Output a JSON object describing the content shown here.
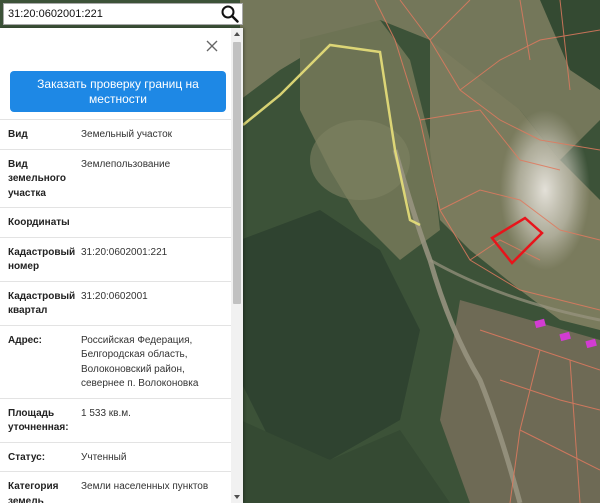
{
  "search": {
    "value": "31:20:0602001:221",
    "icon": "search-icon"
  },
  "panel": {
    "close_icon": "close-icon",
    "order_button_label": "Заказать проверку границ на местности",
    "properties": [
      {
        "label": "Вид",
        "value": "Земельный участок"
      },
      {
        "label": "Вид земельного участка",
        "value": "Землепользование"
      },
      {
        "label": "Координаты",
        "value": ""
      },
      {
        "label": "Кадастровый номер",
        "value": "31:20:0602001:221"
      },
      {
        "label": "Кадастровый квартал",
        "value": "31:20:0602001"
      },
      {
        "label": "Адрес:",
        "value": "Российская Федерация, Белгородская область, Волоконовский район, севернее п. Волоконовка"
      },
      {
        "label": "Площадь уточненная:",
        "value": "1 533 кв.м."
      },
      {
        "label": "Статус:",
        "value": "Учтенный"
      },
      {
        "label": "Категория земель",
        "value": "Земли населенных пунктов"
      }
    ]
  },
  "colors": {
    "accent_button": "#1e88e5",
    "selected_parcel": "#e8141b",
    "parcel_boundary": "#e07a5f",
    "road_highlight": "#e8e07a",
    "marker": "#d23cd2"
  }
}
